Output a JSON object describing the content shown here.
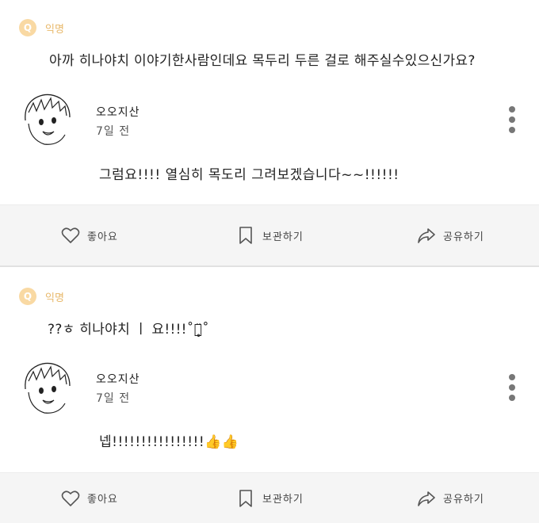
{
  "posts": [
    {
      "badge": "Q",
      "anon_label": "익명",
      "question": "아까 히나야치 이야기한사람인데요 목두리 두른 걸로 해주실수있으신가요?",
      "author": "오오지산",
      "date": "7일 전",
      "answer": "그럼요!!!! 열심히 목도리 그려보겠습니다~~!!!!!!"
    },
    {
      "badge": "Q",
      "anon_label": "익명",
      "question": "??ㅎ 히나야치 ㅣ 요!!!!˚ㅎ̥̈˚",
      "author": "오오지산",
      "date": "7일 전",
      "answer": "넵!!!!!!!!!!!!!!!!👍👍"
    }
  ],
  "actions": {
    "like": "좋아요",
    "save": "보관하기",
    "share": "공유하기"
  },
  "icons": {
    "like": "heart-icon",
    "save": "bookmark-icon",
    "share": "share-arrow-icon",
    "more": "kebab-menu-icon"
  },
  "colors": {
    "badge": "#f9d9a3",
    "anon_label": "#e8b86a",
    "action_bar": "#f5f5f5"
  }
}
